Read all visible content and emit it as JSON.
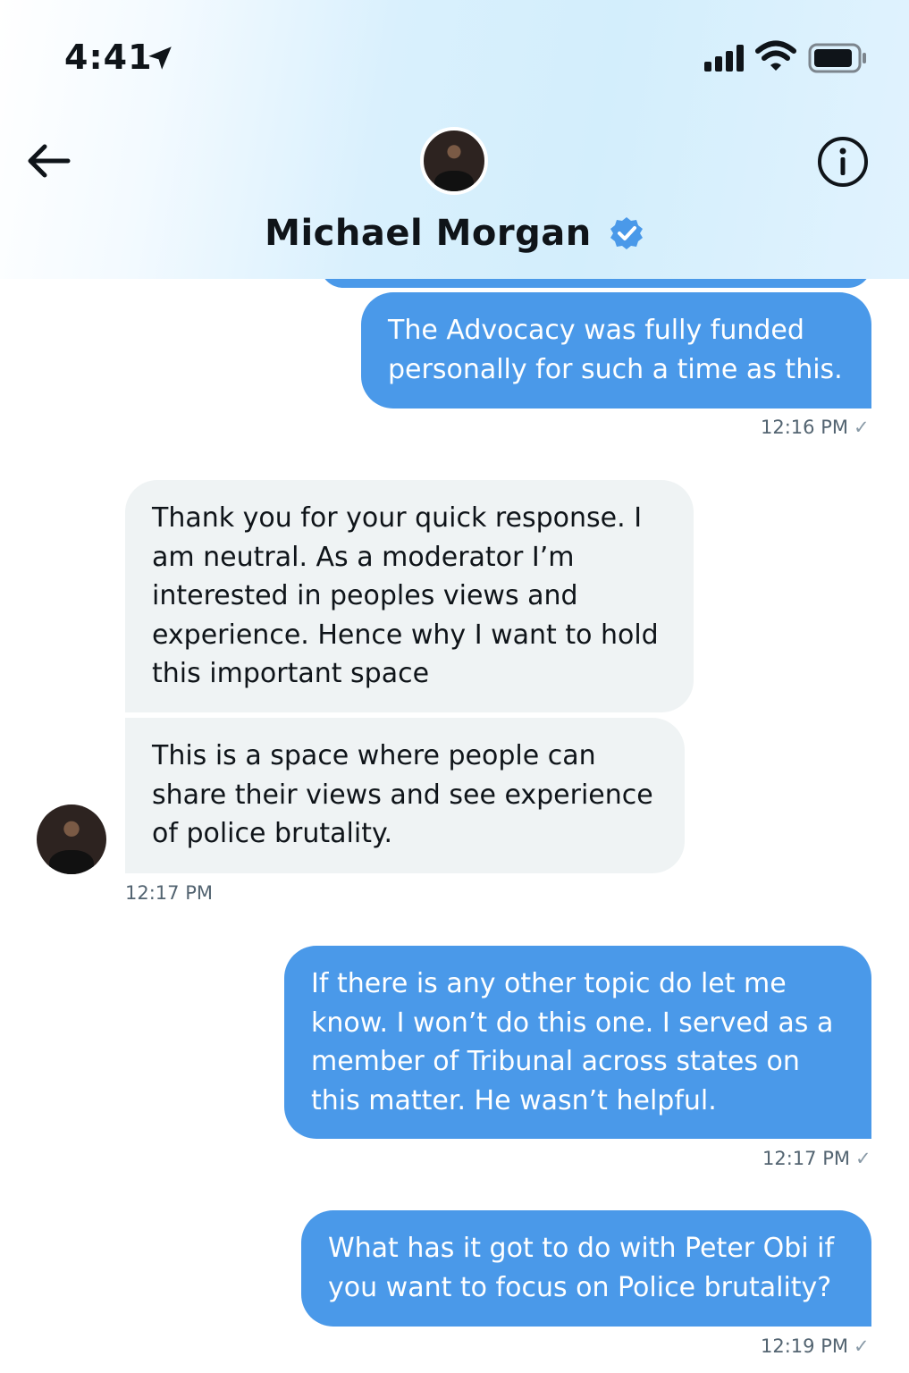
{
  "status_bar": {
    "time": "4:41",
    "icons": [
      "location-arrow-icon",
      "cellular-signal-icon",
      "wifi-icon",
      "battery-icon"
    ]
  },
  "header": {
    "back_icon": "arrow-left-icon",
    "info_icon": "info-icon",
    "contact_name": "Michael Morgan",
    "verified_icon": "verified-badge-icon"
  },
  "messages": [
    {
      "direction": "outgoing",
      "text": "The Advocacy was fully funded personally for such a time as this.",
      "time": "12:16 PM"
    },
    {
      "direction": "incoming",
      "text": "Thank you for your quick response. I am neutral. As a moderator I’m interested in peoples views and experience. Hence why I want to hold this important space"
    },
    {
      "direction": "incoming",
      "text": "This is a space where people can share their views and see experience of police brutality.",
      "time": "12:17 PM"
    },
    {
      "direction": "outgoing",
      "text": "If there is any other topic do let me know. I won’t do this one. I served as a member of Tribunal across states on this matter. He wasn’t helpful.",
      "time": "12:17 PM"
    },
    {
      "direction": "outgoing",
      "text": "What has it got to do with Peter Obi if you want to focus on Police brutality?",
      "time": "12:19 PM"
    }
  ],
  "colors": {
    "outgoing_bubble": "#4a99e9",
    "incoming_bubble": "#eff3f4",
    "verified_blue": "#4a99e9",
    "timestamp": "#536471"
  }
}
